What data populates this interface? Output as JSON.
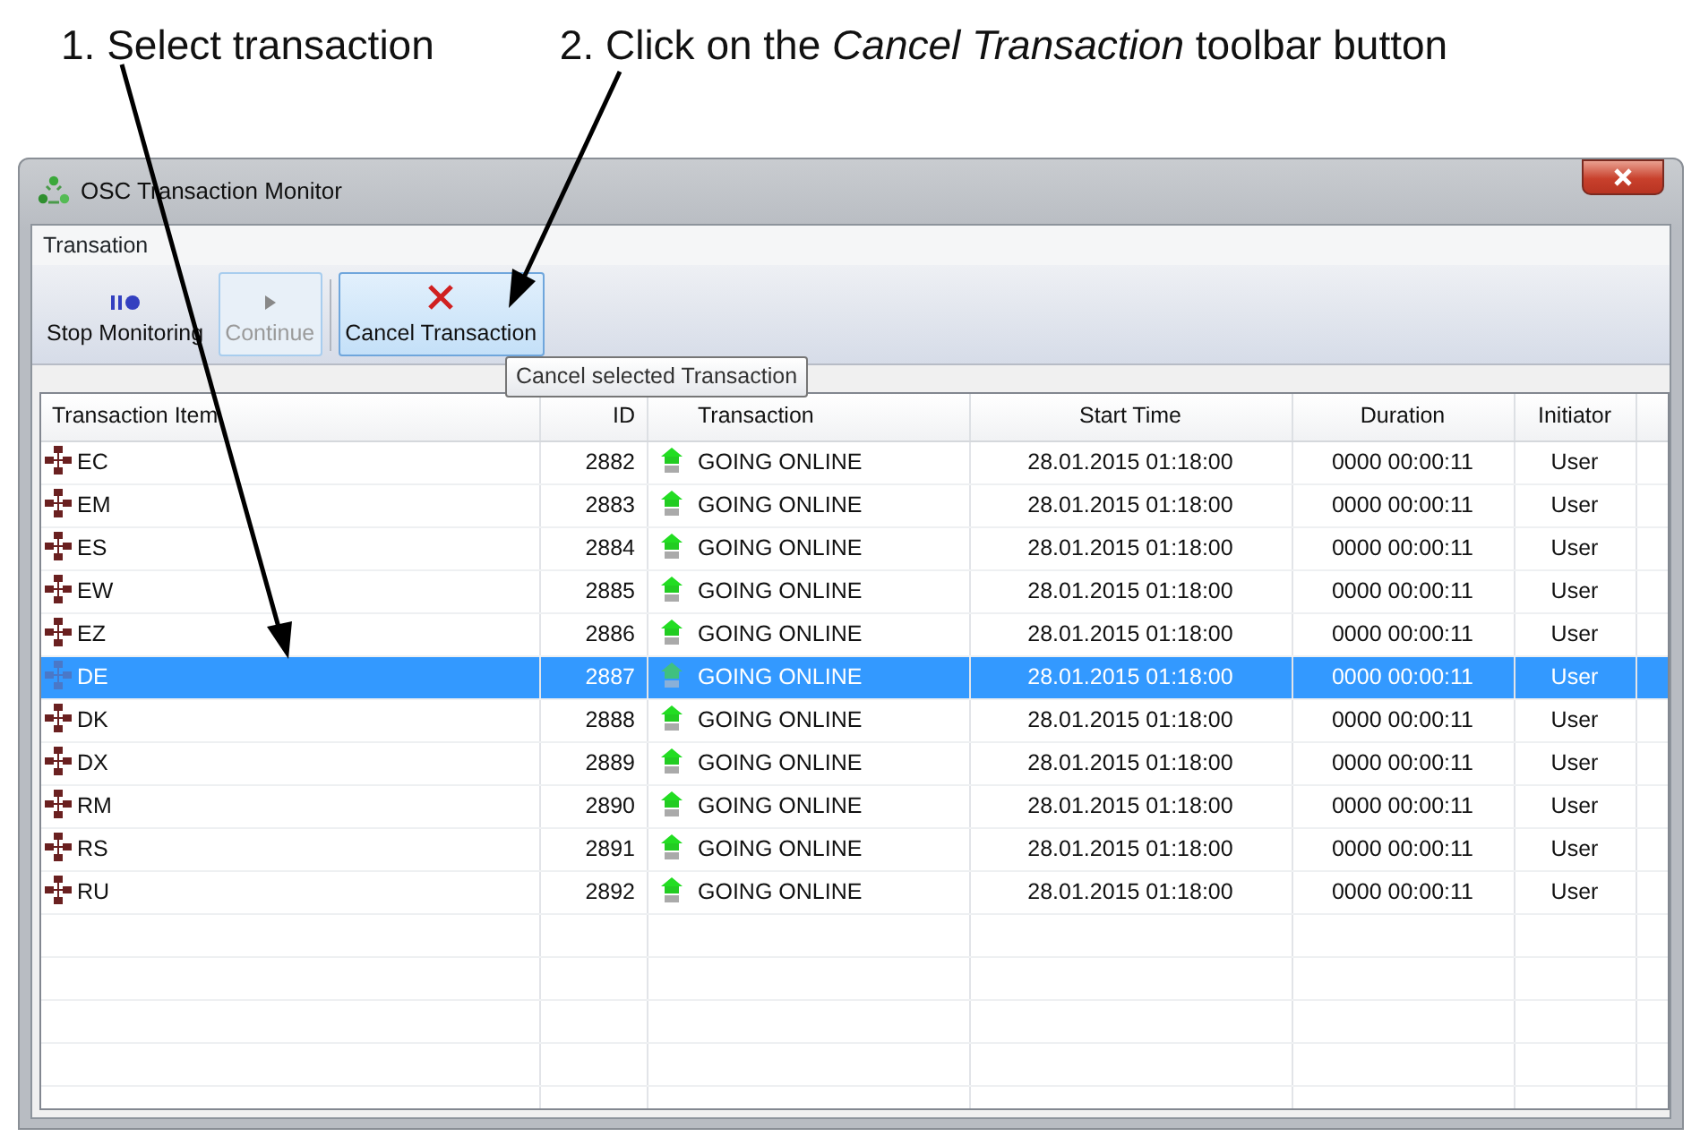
{
  "annotations": [
    {
      "text": "1. Select transaction"
    },
    {
      "text": "2. Click on the *Cancel Transaction* toolbar button"
    }
  ],
  "window": {
    "title": "OSC Transaction Monitor"
  },
  "menu": [
    "Transation"
  ],
  "toolbar": [
    {
      "kind": "pause",
      "label": "Stop Monitoring",
      "disabled": false,
      "highlighted": false
    },
    {
      "kind": "play",
      "label": "Continue",
      "disabled": true,
      "highlighted": false
    },
    {
      "kind": "cancel",
      "label": "Cancel Transaction",
      "disabled": false,
      "highlighted": true
    }
  ],
  "tooltip": "Cancel selected Transaction",
  "table": {
    "columns": [
      "Transaction Item",
      "ID",
      "Transaction",
      "Start Time",
      "Duration",
      "Initiator"
    ],
    "rows": [
      {
        "item": "EC",
        "id": "2882",
        "transaction": "GOING ONLINE",
        "start_time": "28.01.2015 01:18:00",
        "duration": "0000 00:00:11",
        "initiator": "User",
        "selected": false
      },
      {
        "item": "EM",
        "id": "2883",
        "transaction": "GOING ONLINE",
        "start_time": "28.01.2015 01:18:00",
        "duration": "0000 00:00:11",
        "initiator": "User",
        "selected": false
      },
      {
        "item": "ES",
        "id": "2884",
        "transaction": "GOING ONLINE",
        "start_time": "28.01.2015 01:18:00",
        "duration": "0000 00:00:11",
        "initiator": "User",
        "selected": false
      },
      {
        "item": "EW",
        "id": "2885",
        "transaction": "GOING ONLINE",
        "start_time": "28.01.2015 01:18:00",
        "duration": "0000 00:00:11",
        "initiator": "User",
        "selected": false
      },
      {
        "item": "EZ",
        "id": "2886",
        "transaction": "GOING ONLINE",
        "start_time": "28.01.2015 01:18:00",
        "duration": "0000 00:00:11",
        "initiator": "User",
        "selected": false
      },
      {
        "item": "DE",
        "id": "2887",
        "transaction": "GOING ONLINE",
        "start_time": "28.01.2015 01:18:00",
        "duration": "0000 00:00:11",
        "initiator": "User",
        "selected": true
      },
      {
        "item": "DK",
        "id": "2888",
        "transaction": "GOING ONLINE",
        "start_time": "28.01.2015 01:18:00",
        "duration": "0000 00:00:11",
        "initiator": "User",
        "selected": false
      },
      {
        "item": "DX",
        "id": "2889",
        "transaction": "GOING ONLINE",
        "start_time": "28.01.2015 01:18:00",
        "duration": "0000 00:00:11",
        "initiator": "User",
        "selected": false
      },
      {
        "item": "RM",
        "id": "2890",
        "transaction": "GOING ONLINE",
        "start_time": "28.01.2015 01:18:00",
        "duration": "0000 00:00:11",
        "initiator": "User",
        "selected": false
      },
      {
        "item": "RS",
        "id": "2891",
        "transaction": "GOING ONLINE",
        "start_time": "28.01.2015 01:18:00",
        "duration": "0000 00:00:11",
        "initiator": "User",
        "selected": false
      },
      {
        "item": "RU",
        "id": "2892",
        "transaction": "GOING ONLINE",
        "start_time": "28.01.2015 01:18:00",
        "duration": "0000 00:00:11",
        "initiator": "User",
        "selected": false
      }
    ]
  }
}
